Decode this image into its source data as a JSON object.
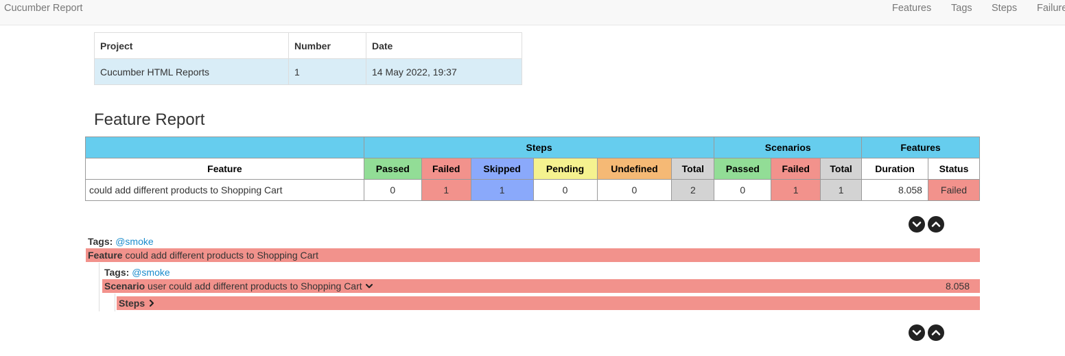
{
  "navbar": {
    "brand": "Cucumber Report",
    "links": [
      "Features",
      "Tags",
      "Steps",
      "Failures"
    ]
  },
  "info_table": {
    "headers": [
      "Project",
      "Number",
      "Date"
    ],
    "row": [
      "Cucumber HTML Reports",
      "1",
      "14 May 2022, 19:37"
    ]
  },
  "feature_report": {
    "title": "Feature Report",
    "group_headers": [
      "Steps",
      "Scenarios",
      "Features"
    ],
    "columns": [
      "Feature",
      "Passed",
      "Failed",
      "Skipped",
      "Pending",
      "Undefined",
      "Total",
      "Passed",
      "Failed",
      "Total",
      "Duration",
      "Status"
    ],
    "row": {
      "feature": "could add different products to Shopping Cart",
      "steps_passed": "0",
      "steps_failed": "1",
      "steps_skipped": "1",
      "steps_pending": "0",
      "steps_undefined": "0",
      "steps_total": "2",
      "scenarios_passed": "0",
      "scenarios_failed": "1",
      "scenarios_total": "1",
      "duration": "8.058",
      "status": "Failed"
    }
  },
  "feature_details": {
    "tags_label": "Tags:",
    "feature_tag": "@smoke",
    "feature_keyword": "Feature",
    "feature_name": "could add different products to Shopping Cart",
    "scenario_tag": "@smoke",
    "scenario_keyword": "Scenario",
    "scenario_name": "user could add different products to Shopping Cart",
    "scenario_duration": "8.058",
    "steps_label": "Steps"
  },
  "colors": {
    "passed": "#92dd96",
    "failed": "#f2928c",
    "skipped": "#8aa9fb",
    "pending": "#f5f28f",
    "undefined": "#f5b975",
    "total": "#d3d3d3",
    "header": "#66cdee",
    "info_row": "#d9edf7",
    "tag_link": "#1a8ccc"
  },
  "icons": {
    "expand_all": "chevron-down-circle-icon",
    "collapse_all": "chevron-up-circle-icon",
    "scenario_toggle": "chevron-down-icon",
    "steps_toggle": "chevron-right-icon"
  }
}
